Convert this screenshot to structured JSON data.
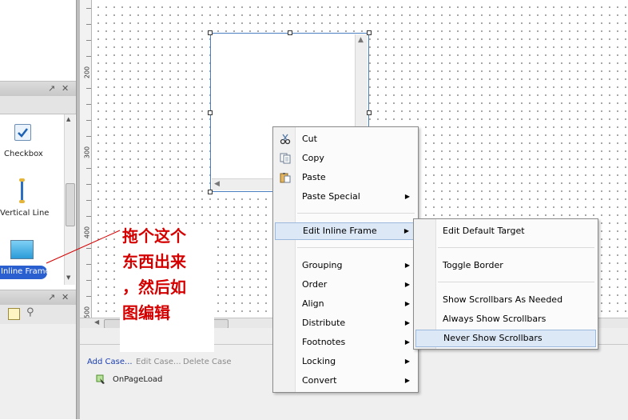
{
  "left_panel": {
    "widgets": [
      {
        "label": "Checkbox",
        "icon": "checkbox-icon"
      },
      {
        "label": "Vertical Line",
        "icon": "vertical-line-icon"
      },
      {
        "label": "Inline Frame",
        "icon": "inline-frame-icon",
        "selected": true
      }
    ]
  },
  "ruler": {
    "labels": [
      "200",
      "300",
      "400",
      "500"
    ]
  },
  "context_menu": {
    "items": [
      {
        "label": "Cut",
        "icon": "scissors-icon"
      },
      {
        "label": "Copy",
        "icon": "copy-icon"
      },
      {
        "label": "Paste",
        "icon": "paste-icon"
      },
      {
        "label": "Paste Special",
        "submenu": true
      },
      {
        "label": "Edit Inline Frame",
        "submenu": true,
        "highlighted": true
      },
      {
        "label": "Grouping",
        "submenu": true
      },
      {
        "label": "Order",
        "submenu": true
      },
      {
        "label": "Align",
        "submenu": true
      },
      {
        "label": "Distribute",
        "submenu": true
      },
      {
        "label": "Footnotes",
        "submenu": true
      },
      {
        "label": "Locking",
        "submenu": true
      },
      {
        "label": "Convert",
        "submenu": true
      }
    ]
  },
  "submenu": {
    "items": [
      {
        "label": "Edit Default Target"
      },
      {
        "label": "Toggle Border"
      },
      {
        "label": "Show Scrollbars As Needed"
      },
      {
        "label": "Always Show Scrollbars"
      },
      {
        "label": "Never Show Scrollbars",
        "highlighted": true
      }
    ]
  },
  "annotation": {
    "lines": [
      "拖个这个",
      "东西出来",
      "，然后如",
      "图编辑"
    ]
  },
  "cases": {
    "add": "Add Case...",
    "edit": "Edit Case...",
    "delete": "Delete Case",
    "event": "OnPageLoad"
  },
  "colors": {
    "accent": "#1a3fb0",
    "annotation": "#d40000",
    "highlight": "#dde8f6"
  }
}
